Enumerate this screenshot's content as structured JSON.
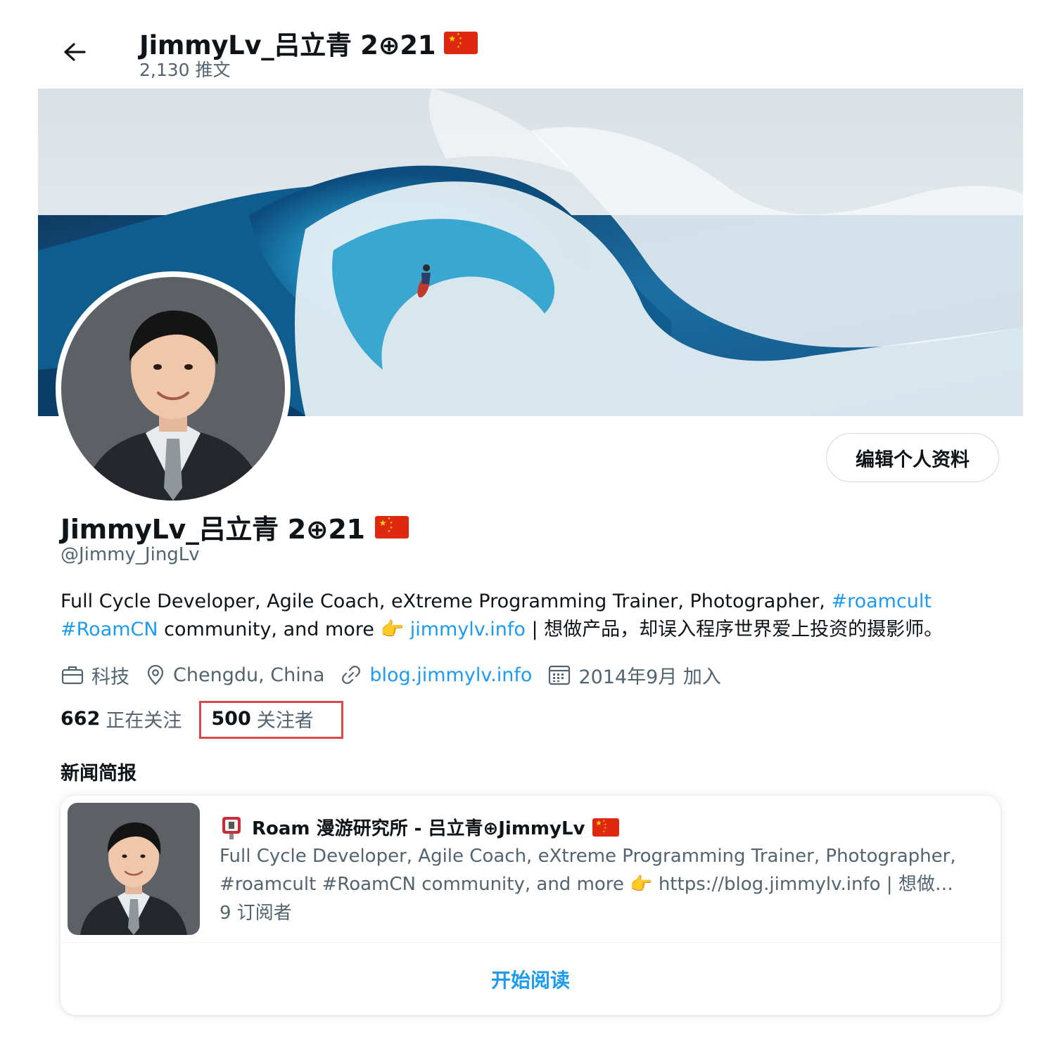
{
  "header": {
    "title": "JimmyLv_吕立青 2⊕21",
    "flag_emoji": "cn-flag",
    "tweet_count": "2,130 推文"
  },
  "profile": {
    "edit_button": "编辑个人资料",
    "display_name": "JimmyLv_吕立青 2⊕21",
    "handle": "@Jimmy_JingLv",
    "bio": {
      "text1": "Full Cycle Developer, Agile Coach, eXtreme Programming Trainer, Photographer, ",
      "tag1": "#roamcult",
      "tag2": "#RoamCN",
      "text2": " community, and more 👉 ",
      "link": "jimmylv.info",
      "text3": " | 想做产品，却误入程序世界爱上投资的摄影师。"
    },
    "meta": {
      "category": "科技",
      "location": "Chengdu, China",
      "website": "blog.jimmylv.info",
      "joined": "2014年9月 加入"
    },
    "stats": {
      "following_count": "662",
      "following_label": "正在关注",
      "followers_count": "500",
      "followers_label": "关注者"
    }
  },
  "newsletter": {
    "heading": "新闻简报",
    "title": "Roam 漫游研究所 - 吕立青⊕JimmyLv",
    "desc_line1": "Full Cycle Developer, Agile Coach, eXtreme Programming Trainer, Photographer,",
    "desc_line2": "#roamcult #RoamCN community, and more 👉 https://blog.jimmylv.info | 想做…",
    "subscribers": "9 订阅者",
    "action": "开始阅读"
  },
  "colors": {
    "accent": "#1d9bf0",
    "secondary_text": "#536471",
    "highlight": "#d84a4a",
    "flag_red": "#de2910",
    "flag_yellow": "#ffde00"
  }
}
